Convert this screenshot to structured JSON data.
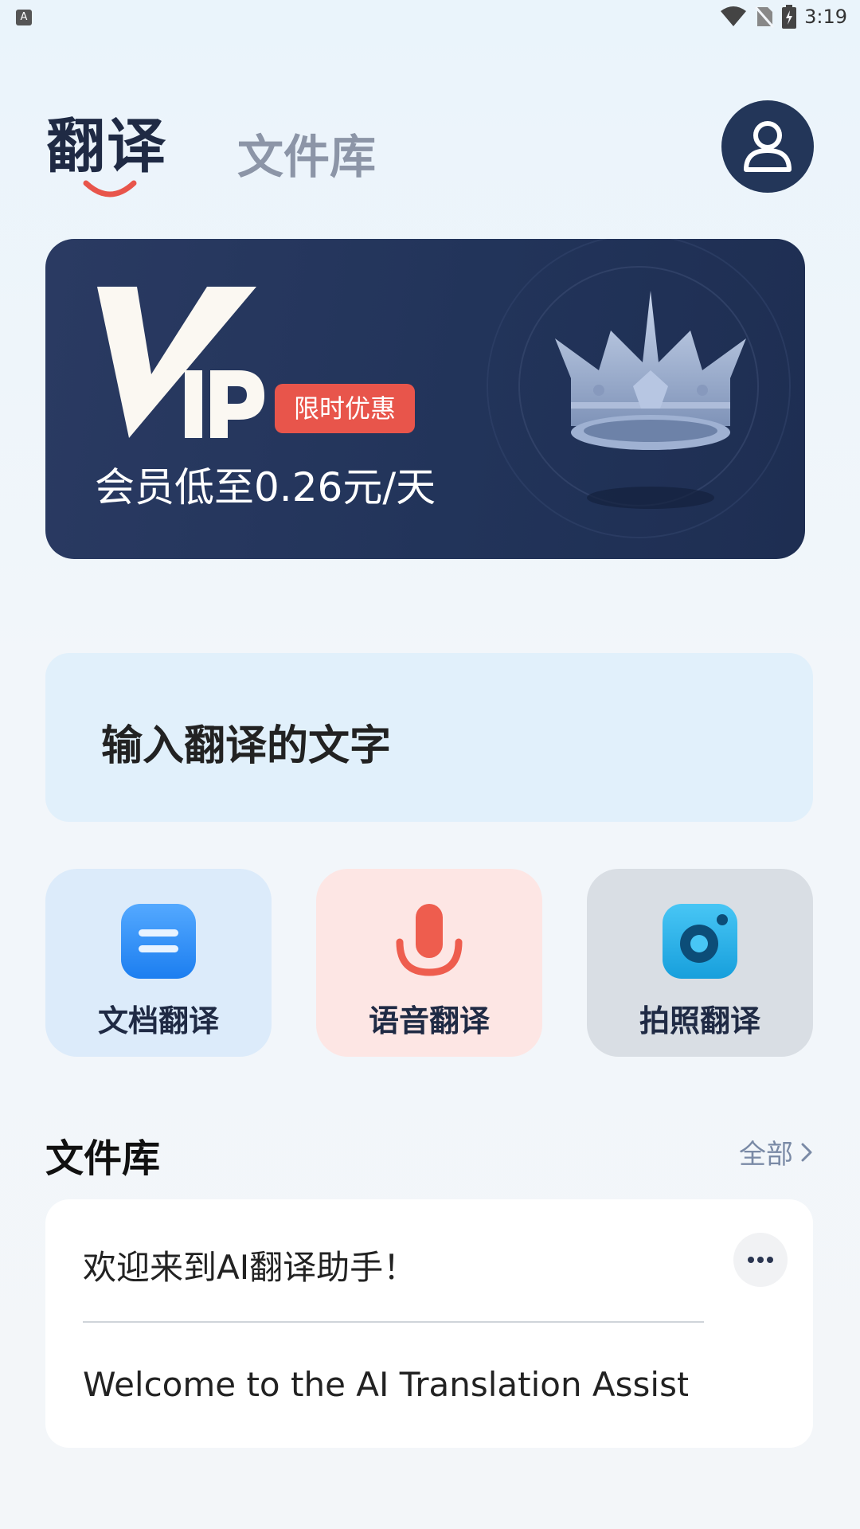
{
  "status_bar": {
    "notification_badge": "A",
    "time": "3:19",
    "icons": [
      "wifi-icon",
      "no-sim-icon",
      "battery-charging-icon"
    ]
  },
  "header": {
    "tabs": [
      {
        "label": "翻译",
        "active": true
      },
      {
        "label": "文件库",
        "active": false
      }
    ],
    "avatar_icon": "user-icon"
  },
  "vip_banner": {
    "logo_text": "VIP",
    "badge": "限时优惠",
    "subtitle": "会员低至0.26元/天",
    "image": "crown"
  },
  "input_card": {
    "placeholder": "输入翻译的文字"
  },
  "features": [
    {
      "label": "文档翻译",
      "icon": "document-icon"
    },
    {
      "label": "语音翻译",
      "icon": "microphone-icon"
    },
    {
      "label": "拍照翻译",
      "icon": "camera-icon"
    }
  ],
  "library": {
    "title": "文件库",
    "see_all": "全部",
    "items": [
      {
        "source": "欢迎来到AI翻译助手！",
        "translation": "Welcome to the AI Translation Assist..."
      }
    ]
  },
  "colors": {
    "accent_red": "#e8554b",
    "navy": "#233659",
    "doc_blue": "#2d8ff5",
    "camera_cyan": "#23b3ea"
  }
}
